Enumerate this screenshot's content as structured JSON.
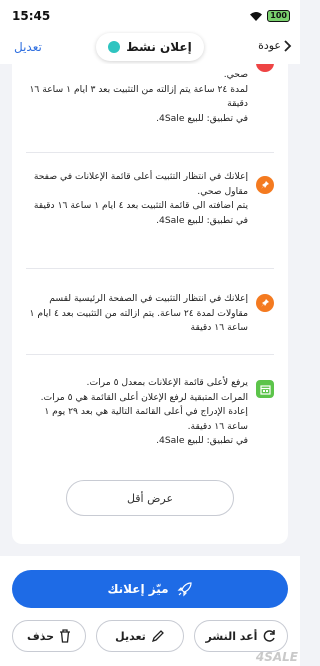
{
  "status_bar": {
    "time": "15:45",
    "battery": "100"
  },
  "header": {
    "edit_label": "تعديل",
    "status_label": "إعلان نشط",
    "back_label": "عودة"
  },
  "notifications": [
    {
      "icon": "pin-icon",
      "lines": [
        "صحي.",
        "لمدة ٢٤ ساعة يتم إزالته من التثبيت بعد ٣ ايام ١ ساعة ١٦ دقيقة",
        "في تطبيق: للبيع 4Sale."
      ]
    },
    {
      "icon": "pin-icon",
      "lines": [
        "إعلانك في انتظار التثبيت أعلى قائمة الإعلانات في صفحة مقاول صحي.",
        "يتم اضافته الى قائمة التثبيت بعد ٤ ايام ١ ساعة ١٦ دقيقة",
        "في تطبيق: للبيع 4Sale."
      ]
    },
    {
      "icon": "pin-icon",
      "lines": [
        "إعلانك في انتظار التثبيت في الصفحة الرئيسية لقسم مقاولات لمدة ٢٤ ساعة. يتم ازالته من التثبيت بعد ٤ ايام ١ ساعة ١٦ دقيقة"
      ]
    },
    {
      "icon": "calendar-icon",
      "lines": [
        "يرفع لأعلى قائمة الإعلانات بمعدل ٥ مرات.",
        "المرات المتبقية لرفع الإعلان أعلى القائمة هي ٥ مرات.",
        "إعادة الإدراج في أعلى القائمة التالية هي بعد ٢٩ يوم ١ ساعة ١٦ دقيقة.",
        "في تطبيق: للبيع 4Sale."
      ]
    }
  ],
  "show_less_label": "عرض أقل",
  "actions": {
    "promote_label": "ميّز إعلانك",
    "delete_label": "حذف",
    "edit_label": "تعديل",
    "repost_label": "أعد النشر"
  },
  "watermark": "4SALE",
  "colors": {
    "accent": "#1e6be6",
    "active": "#2ec4c0",
    "pin": "#f47a20",
    "calendar": "#5cc44a"
  }
}
